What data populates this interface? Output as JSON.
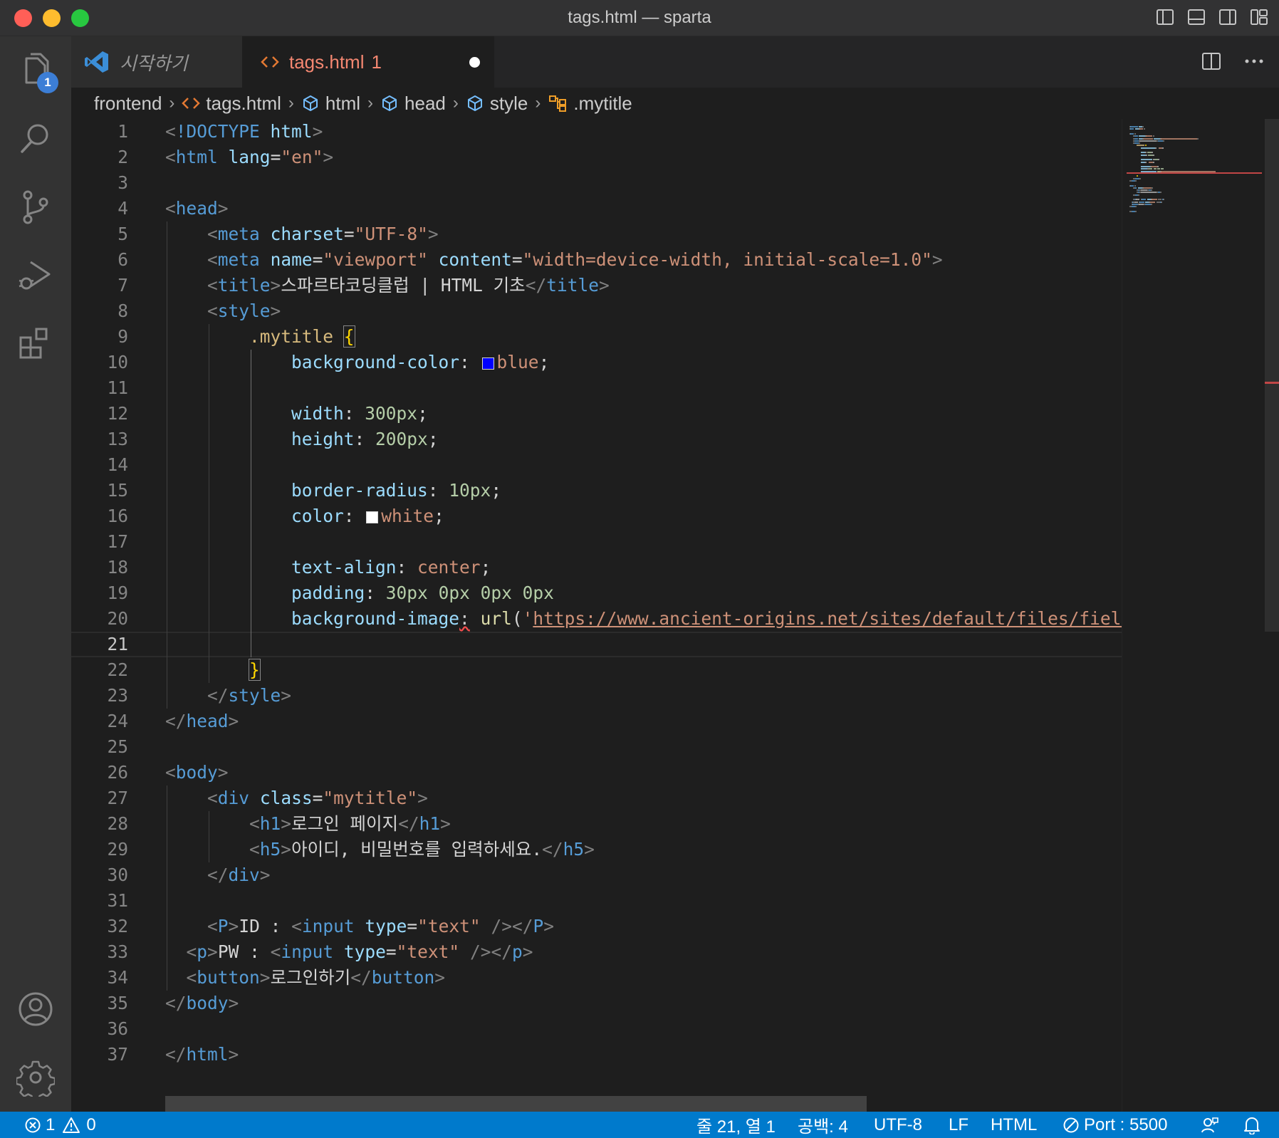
{
  "window": {
    "title": "tags.html — sparta"
  },
  "activity_bar": {
    "explorer_badge": "1"
  },
  "tabs": [
    {
      "label": "시작하기"
    },
    {
      "label": "tags.html",
      "problems": "1"
    }
  ],
  "breadcrumbs": [
    "frontend",
    "tags.html",
    "html",
    "head",
    "style",
    ".mytitle"
  ],
  "editor": {
    "current_line": 21,
    "lines": [
      {
        "n": "1",
        "tokens": [
          [
            "t-punc",
            "<"
          ],
          [
            "t-tag",
            "!DOCTYPE"
          ],
          [
            "t-text",
            " "
          ],
          [
            "t-attr",
            "html"
          ],
          [
            "t-punc",
            ">"
          ]
        ]
      },
      {
        "n": "2",
        "tokens": [
          [
            "t-punc",
            "<"
          ],
          [
            "t-tag",
            "html"
          ],
          [
            "t-text",
            " "
          ],
          [
            "t-attr",
            "lang"
          ],
          [
            "t-text",
            "="
          ],
          [
            "t-str",
            "\"en\""
          ],
          [
            "t-punc",
            ">"
          ]
        ]
      },
      {
        "n": "3",
        "tokens": []
      },
      {
        "n": "4",
        "tokens": [
          [
            "t-punc",
            "<"
          ],
          [
            "t-tag",
            "head"
          ],
          [
            "t-punc",
            ">"
          ]
        ]
      },
      {
        "n": "5",
        "tokens": [
          [
            "t-text",
            "    "
          ],
          [
            "t-punc",
            "<"
          ],
          [
            "t-tag",
            "meta"
          ],
          [
            "t-text",
            " "
          ],
          [
            "t-attr",
            "charset"
          ],
          [
            "t-text",
            "="
          ],
          [
            "t-str",
            "\"UTF-8\""
          ],
          [
            "t-punc",
            ">"
          ]
        ]
      },
      {
        "n": "6",
        "tokens": [
          [
            "t-text",
            "    "
          ],
          [
            "t-punc",
            "<"
          ],
          [
            "t-tag",
            "meta"
          ],
          [
            "t-text",
            " "
          ],
          [
            "t-attr",
            "name"
          ],
          [
            "t-text",
            "="
          ],
          [
            "t-str",
            "\"viewport\""
          ],
          [
            "t-text",
            " "
          ],
          [
            "t-attr",
            "content"
          ],
          [
            "t-text",
            "="
          ],
          [
            "t-str",
            "\"width=device-width, initial-scale=1.0\""
          ],
          [
            "t-punc",
            ">"
          ]
        ]
      },
      {
        "n": "7",
        "tokens": [
          [
            "t-text",
            "    "
          ],
          [
            "t-punc",
            "<"
          ],
          [
            "t-tag",
            "title"
          ],
          [
            "t-punc",
            ">"
          ],
          [
            "t-text",
            "스파르타코딩클럽 | HTML 기초"
          ],
          [
            "t-punc",
            "</"
          ],
          [
            "t-tag",
            "title"
          ],
          [
            "t-punc",
            ">"
          ]
        ]
      },
      {
        "n": "8",
        "tokens": [
          [
            "t-text",
            "    "
          ],
          [
            "t-punc",
            "<"
          ],
          [
            "t-tag",
            "style"
          ],
          [
            "t-punc",
            ">"
          ]
        ]
      },
      {
        "n": "9",
        "tokens": [
          [
            "t-text",
            "        "
          ],
          [
            "t-sel",
            ".mytitle"
          ],
          [
            "t-text",
            " "
          ],
          [
            "t-brace",
            "{"
          ]
        ]
      },
      {
        "n": "10",
        "tokens": [
          [
            "t-text",
            "            "
          ],
          [
            "t-prop",
            "background-color"
          ],
          [
            "t-text",
            ": "
          ],
          [
            "swatch",
            "#0000ff"
          ],
          [
            "t-val",
            "blue"
          ],
          [
            "t-text",
            ";"
          ]
        ]
      },
      {
        "n": "11",
        "tokens": []
      },
      {
        "n": "12",
        "tokens": [
          [
            "t-text",
            "            "
          ],
          [
            "t-prop",
            "width"
          ],
          [
            "t-text",
            ": "
          ],
          [
            "t-num",
            "300px"
          ],
          [
            "t-text",
            ";"
          ]
        ]
      },
      {
        "n": "13",
        "tokens": [
          [
            "t-text",
            "            "
          ],
          [
            "t-prop",
            "height"
          ],
          [
            "t-text",
            ": "
          ],
          [
            "t-num",
            "200px"
          ],
          [
            "t-text",
            ";"
          ]
        ]
      },
      {
        "n": "14",
        "tokens": []
      },
      {
        "n": "15",
        "tokens": [
          [
            "t-text",
            "            "
          ],
          [
            "t-prop",
            "border-radius"
          ],
          [
            "t-text",
            ": "
          ],
          [
            "t-num",
            "10px"
          ],
          [
            "t-text",
            ";"
          ]
        ]
      },
      {
        "n": "16",
        "tokens": [
          [
            "t-text",
            "            "
          ],
          [
            "t-prop",
            "color"
          ],
          [
            "t-text",
            ": "
          ],
          [
            "swatch",
            "#ffffff"
          ],
          [
            "t-val",
            "white"
          ],
          [
            "t-text",
            ";"
          ]
        ]
      },
      {
        "n": "17",
        "tokens": []
      },
      {
        "n": "18",
        "tokens": [
          [
            "t-text",
            "            "
          ],
          [
            "t-prop",
            "text-align"
          ],
          [
            "t-text",
            ": "
          ],
          [
            "t-val",
            "center"
          ],
          [
            "t-text",
            ";"
          ]
        ]
      },
      {
        "n": "19",
        "tokens": [
          [
            "t-text",
            "            "
          ],
          [
            "t-prop",
            "padding"
          ],
          [
            "t-text",
            ": "
          ],
          [
            "t-num",
            "30px"
          ],
          [
            "t-text",
            " "
          ],
          [
            "t-num",
            "0px"
          ],
          [
            "t-text",
            " "
          ],
          [
            "t-num",
            "0px"
          ],
          [
            "t-text",
            " "
          ],
          [
            "t-num",
            "0px"
          ]
        ]
      },
      {
        "n": "20",
        "tokens": [
          [
            "t-text",
            "            "
          ],
          [
            "t-prop",
            "background-image"
          ],
          [
            "squiggle",
            ":"
          ],
          [
            "t-text",
            " "
          ],
          [
            "t-fn",
            "url"
          ],
          [
            "t-text",
            "("
          ],
          [
            "t-str",
            "'"
          ],
          [
            "t-url",
            "https://www.ancient-origins.net/sites/default/files/field/"
          ]
        ]
      },
      {
        "n": "21",
        "tokens": []
      },
      {
        "n": "22",
        "tokens": [
          [
            "t-text",
            "        "
          ],
          [
            "t-brace",
            "}"
          ]
        ]
      },
      {
        "n": "23",
        "tokens": [
          [
            "t-text",
            "    "
          ],
          [
            "t-punc",
            "</"
          ],
          [
            "t-tag",
            "style"
          ],
          [
            "t-punc",
            ">"
          ]
        ]
      },
      {
        "n": "24",
        "tokens": [
          [
            "t-punc",
            "</"
          ],
          [
            "t-tag",
            "head"
          ],
          [
            "t-punc",
            ">"
          ]
        ]
      },
      {
        "n": "25",
        "tokens": []
      },
      {
        "n": "26",
        "tokens": [
          [
            "t-punc",
            "<"
          ],
          [
            "t-tag",
            "body"
          ],
          [
            "t-punc",
            ">"
          ]
        ]
      },
      {
        "n": "27",
        "tokens": [
          [
            "t-text",
            "    "
          ],
          [
            "t-punc",
            "<"
          ],
          [
            "t-tag",
            "div"
          ],
          [
            "t-text",
            " "
          ],
          [
            "t-attr",
            "class"
          ],
          [
            "t-text",
            "="
          ],
          [
            "t-str",
            "\"mytitle\""
          ],
          [
            "t-punc",
            ">"
          ]
        ]
      },
      {
        "n": "28",
        "tokens": [
          [
            "t-text",
            "        "
          ],
          [
            "t-punc",
            "<"
          ],
          [
            "t-tag",
            "h1"
          ],
          [
            "t-punc",
            ">"
          ],
          [
            "t-text",
            "로그인 페이지"
          ],
          [
            "t-punc",
            "</"
          ],
          [
            "t-tag",
            "h1"
          ],
          [
            "t-punc",
            ">"
          ]
        ]
      },
      {
        "n": "29",
        "tokens": [
          [
            "t-text",
            "        "
          ],
          [
            "t-punc",
            "<"
          ],
          [
            "t-tag",
            "h5"
          ],
          [
            "t-punc",
            ">"
          ],
          [
            "t-text",
            "아이디, 비밀번호를 입력하세요."
          ],
          [
            "t-punc",
            "</"
          ],
          [
            "t-tag",
            "h5"
          ],
          [
            "t-punc",
            ">"
          ]
        ]
      },
      {
        "n": "30",
        "tokens": [
          [
            "t-text",
            "    "
          ],
          [
            "t-punc",
            "</"
          ],
          [
            "t-tag",
            "div"
          ],
          [
            "t-punc",
            ">"
          ]
        ]
      },
      {
        "n": "31",
        "tokens": []
      },
      {
        "n": "32",
        "tokens": [
          [
            "t-text",
            "    "
          ],
          [
            "t-punc",
            "<"
          ],
          [
            "t-tag",
            "P"
          ],
          [
            "t-punc",
            ">"
          ],
          [
            "t-text",
            "ID : "
          ],
          [
            "t-punc",
            "<"
          ],
          [
            "t-tag",
            "input"
          ],
          [
            "t-text",
            " "
          ],
          [
            "t-attr",
            "type"
          ],
          [
            "t-text",
            "="
          ],
          [
            "t-str",
            "\"text\""
          ],
          [
            "t-text",
            " "
          ],
          [
            "t-punc",
            "/></"
          ],
          [
            "t-tag",
            "P"
          ],
          [
            "t-punc",
            ">"
          ]
        ]
      },
      {
        "n": "33",
        "tokens": [
          [
            "t-text",
            "  "
          ],
          [
            "t-punc",
            "<"
          ],
          [
            "t-tag",
            "p"
          ],
          [
            "t-punc",
            ">"
          ],
          [
            "t-text",
            "PW : "
          ],
          [
            "t-punc",
            "<"
          ],
          [
            "t-tag",
            "input"
          ],
          [
            "t-text",
            " "
          ],
          [
            "t-attr",
            "type"
          ],
          [
            "t-text",
            "="
          ],
          [
            "t-str",
            "\"text\""
          ],
          [
            "t-text",
            " "
          ],
          [
            "t-punc",
            "/></"
          ],
          [
            "t-tag",
            "p"
          ],
          [
            "t-punc",
            ">"
          ]
        ]
      },
      {
        "n": "34",
        "tokens": [
          [
            "t-text",
            "  "
          ],
          [
            "t-punc",
            "<"
          ],
          [
            "t-tag",
            "button"
          ],
          [
            "t-punc",
            ">"
          ],
          [
            "t-text",
            "로그인하기"
          ],
          [
            "t-punc",
            "</"
          ],
          [
            "t-tag",
            "button"
          ],
          [
            "t-punc",
            ">"
          ]
        ]
      },
      {
        "n": "35",
        "tokens": [
          [
            "t-punc",
            "</"
          ],
          [
            "t-tag",
            "body"
          ],
          [
            "t-punc",
            ">"
          ]
        ]
      },
      {
        "n": "36",
        "tokens": []
      },
      {
        "n": "37",
        "tokens": [
          [
            "t-punc",
            "</"
          ],
          [
            "t-tag",
            "html"
          ],
          [
            "t-punc",
            ">"
          ]
        ]
      }
    ]
  },
  "status_bar": {
    "errors": "1",
    "warnings": "0",
    "cursor": "줄 21, 열 1",
    "indent": "공백: 4",
    "encoding": "UTF-8",
    "eol": "LF",
    "language": "HTML",
    "port": "Port : 5500"
  },
  "icons": {
    "activity": [
      "files-icon",
      "search-icon",
      "source-control-icon",
      "run-debug-icon",
      "extensions-icon",
      "account-icon",
      "settings-gear-icon"
    ],
    "tab_actions": [
      "split-editor-icon",
      "more-actions-icon"
    ],
    "layout": [
      "toggle-primary-sidebar-icon",
      "toggle-panel-icon",
      "toggle-secondary-sidebar-icon",
      "customize-layout-icon"
    ]
  },
  "colors": {
    "accent": "#007acc",
    "editor_bg": "#1e1e1e",
    "tab_dirty_label": "#f48771"
  }
}
